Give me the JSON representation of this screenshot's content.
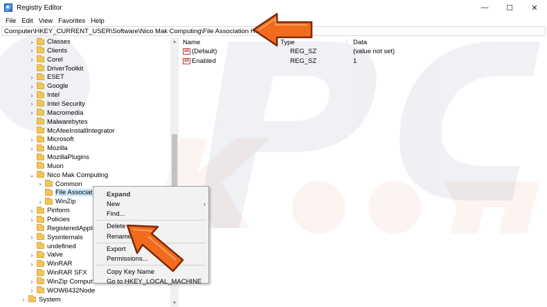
{
  "window": {
    "title": "Registry Editor",
    "controls": {
      "minimize": "—",
      "maximize": "☐",
      "close": "✕"
    }
  },
  "menubar": [
    "File",
    "Edit",
    "View",
    "Favorites",
    "Help"
  ],
  "address": "Computer\\HKEY_CURRENT_USER\\Software\\Nico Mak Computing\\File Association Helper",
  "tree": [
    {
      "label": "Classes",
      "expander": "›"
    },
    {
      "label": "Clients",
      "expander": "›"
    },
    {
      "label": "Corel",
      "expander": "›"
    },
    {
      "label": "DriverToolkit",
      "expander": ""
    },
    {
      "label": "ESET",
      "expander": "›"
    },
    {
      "label": "Google",
      "expander": "›"
    },
    {
      "label": "Intel",
      "expander": "›"
    },
    {
      "label": "Intel Security",
      "expander": "›"
    },
    {
      "label": "Macromedia",
      "expander": "›"
    },
    {
      "label": "Malwarebytes",
      "expander": ""
    },
    {
      "label": "McAfeeInstallIntegrator",
      "expander": ""
    },
    {
      "label": "Microsoft",
      "expander": "›"
    },
    {
      "label": "Mozilla",
      "expander": "›"
    },
    {
      "label": "MozillaPlugins",
      "expander": ""
    },
    {
      "label": "Muon",
      "expander": ""
    },
    {
      "label": "Nico Mak Computing",
      "expander": "⌄"
    },
    {
      "label": "Common",
      "expander": "›",
      "child": true
    },
    {
      "label": "File Associatio",
      "expander": "",
      "child": true,
      "selected": true
    },
    {
      "label": "WinZip",
      "expander": "›",
      "child": true
    },
    {
      "label": "Piriform",
      "expander": "›"
    },
    {
      "label": "Policies",
      "expander": "›"
    },
    {
      "label": "RegisteredApplica",
      "expander": ""
    },
    {
      "label": "Sysinternals",
      "expander": "›"
    },
    {
      "label": "undefined",
      "expander": ""
    },
    {
      "label": "Valve",
      "expander": "›"
    },
    {
      "label": "WinRAR",
      "expander": "›"
    },
    {
      "label": "WinRAR SFX",
      "expander": ""
    },
    {
      "label": "WinZip Computir",
      "expander": "›"
    },
    {
      "label": "WOW6432Node",
      "expander": "›"
    },
    {
      "label": "System",
      "expander": "›",
      "root": true
    }
  ],
  "columns": {
    "name": "Name",
    "type": "Type",
    "data": "Data"
  },
  "values": [
    {
      "name": "(Default)",
      "type": "REG_SZ",
      "data": "(value not set)",
      "icon": "ab"
    },
    {
      "name": "Enabled",
      "type": "REG_SZ",
      "data": "1",
      "icon": "ab"
    }
  ],
  "context_menu": {
    "items": [
      {
        "label": "Expand",
        "bold": true
      },
      {
        "label": "New",
        "submenu": "›"
      },
      {
        "label": "Find..."
      },
      {
        "sep": true
      },
      {
        "label": "Delete"
      },
      {
        "label": "Rename"
      },
      {
        "sep": true
      },
      {
        "label": "Export"
      },
      {
        "label": "Permissions..."
      },
      {
        "sep": true
      },
      {
        "label": "Copy Key Name"
      },
      {
        "label": "Go to HKEY_LOCAL_MACHINE"
      }
    ]
  },
  "colors": {
    "arrow": "#f26b1d",
    "selection": "#cce8ff",
    "folder": "#f1c65c"
  }
}
